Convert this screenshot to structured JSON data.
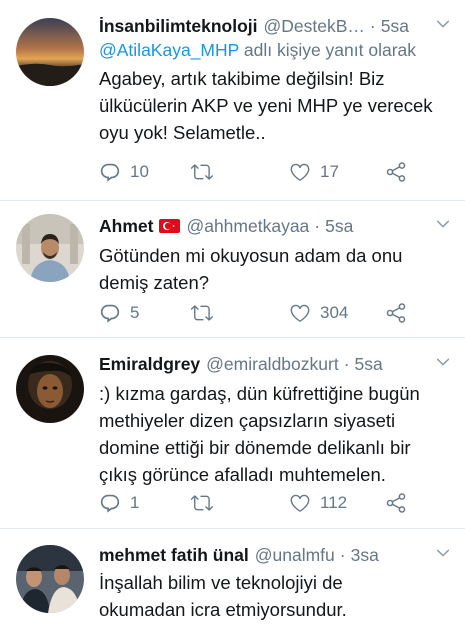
{
  "tweets": [
    {
      "name": "İnsanbilimteknoloji",
      "handle": "@DestekB…",
      "time": "5sa",
      "reply_prefix": "",
      "reply_mention": "@AtilaKaya_MHP",
      "reply_suffix": " adlı kişiye yanıt olarak",
      "lines": [
        "Agabey, artık takibime değilsin! Biz",
        "ülkücülerin AKP ve yeni MHP ye verecek",
        "oyu yok! Selametle.."
      ],
      "replies": "10",
      "retweets": "",
      "likes": "17",
      "avatar": "sunset"
    },
    {
      "name": "Ahmet",
      "handle": "@ahhmetkayaa",
      "time": "5sa",
      "flag": "turkey-flag",
      "lines": [
        "Götünden mi okuyosun adam da onu",
        "demiş zaten?"
      ],
      "replies": "5",
      "retweets": "",
      "likes": "304",
      "avatar": "man-portrait"
    },
    {
      "name": "Emiraldgrey",
      "handle": "@emiraldbozkurt",
      "time": "5sa",
      "lines": [
        ":) kızma gardaş, dün küfrettiğine bugün",
        "methiyeler dizen çapsızların siyaseti",
        "domine ettiği bir dönemde delikanlı bir",
        "çıkış görünce afalladı muhtemelen."
      ],
      "replies": "1",
      "retweets": "",
      "likes": "112",
      "avatar": "dark-portrait"
    },
    {
      "name": "mehmet fatih ünal",
      "handle": "@unalmfu",
      "time": "3sa",
      "lines": [
        "İnşallah bilim ve teknolojiyi de",
        "okumadan icra etmiyorsundur."
      ],
      "avatar": "group-photo"
    }
  ],
  "icons": {
    "reply": "reply-icon",
    "retweet": "retweet-icon",
    "like": "heart-icon",
    "share": "share-icon",
    "more": "chevron-down-icon"
  },
  "colors": {
    "text": "#14171a",
    "muted": "#657786",
    "link": "#1b95e0",
    "separator": "#e1e8ed",
    "flag_red": "#e30a17"
  }
}
